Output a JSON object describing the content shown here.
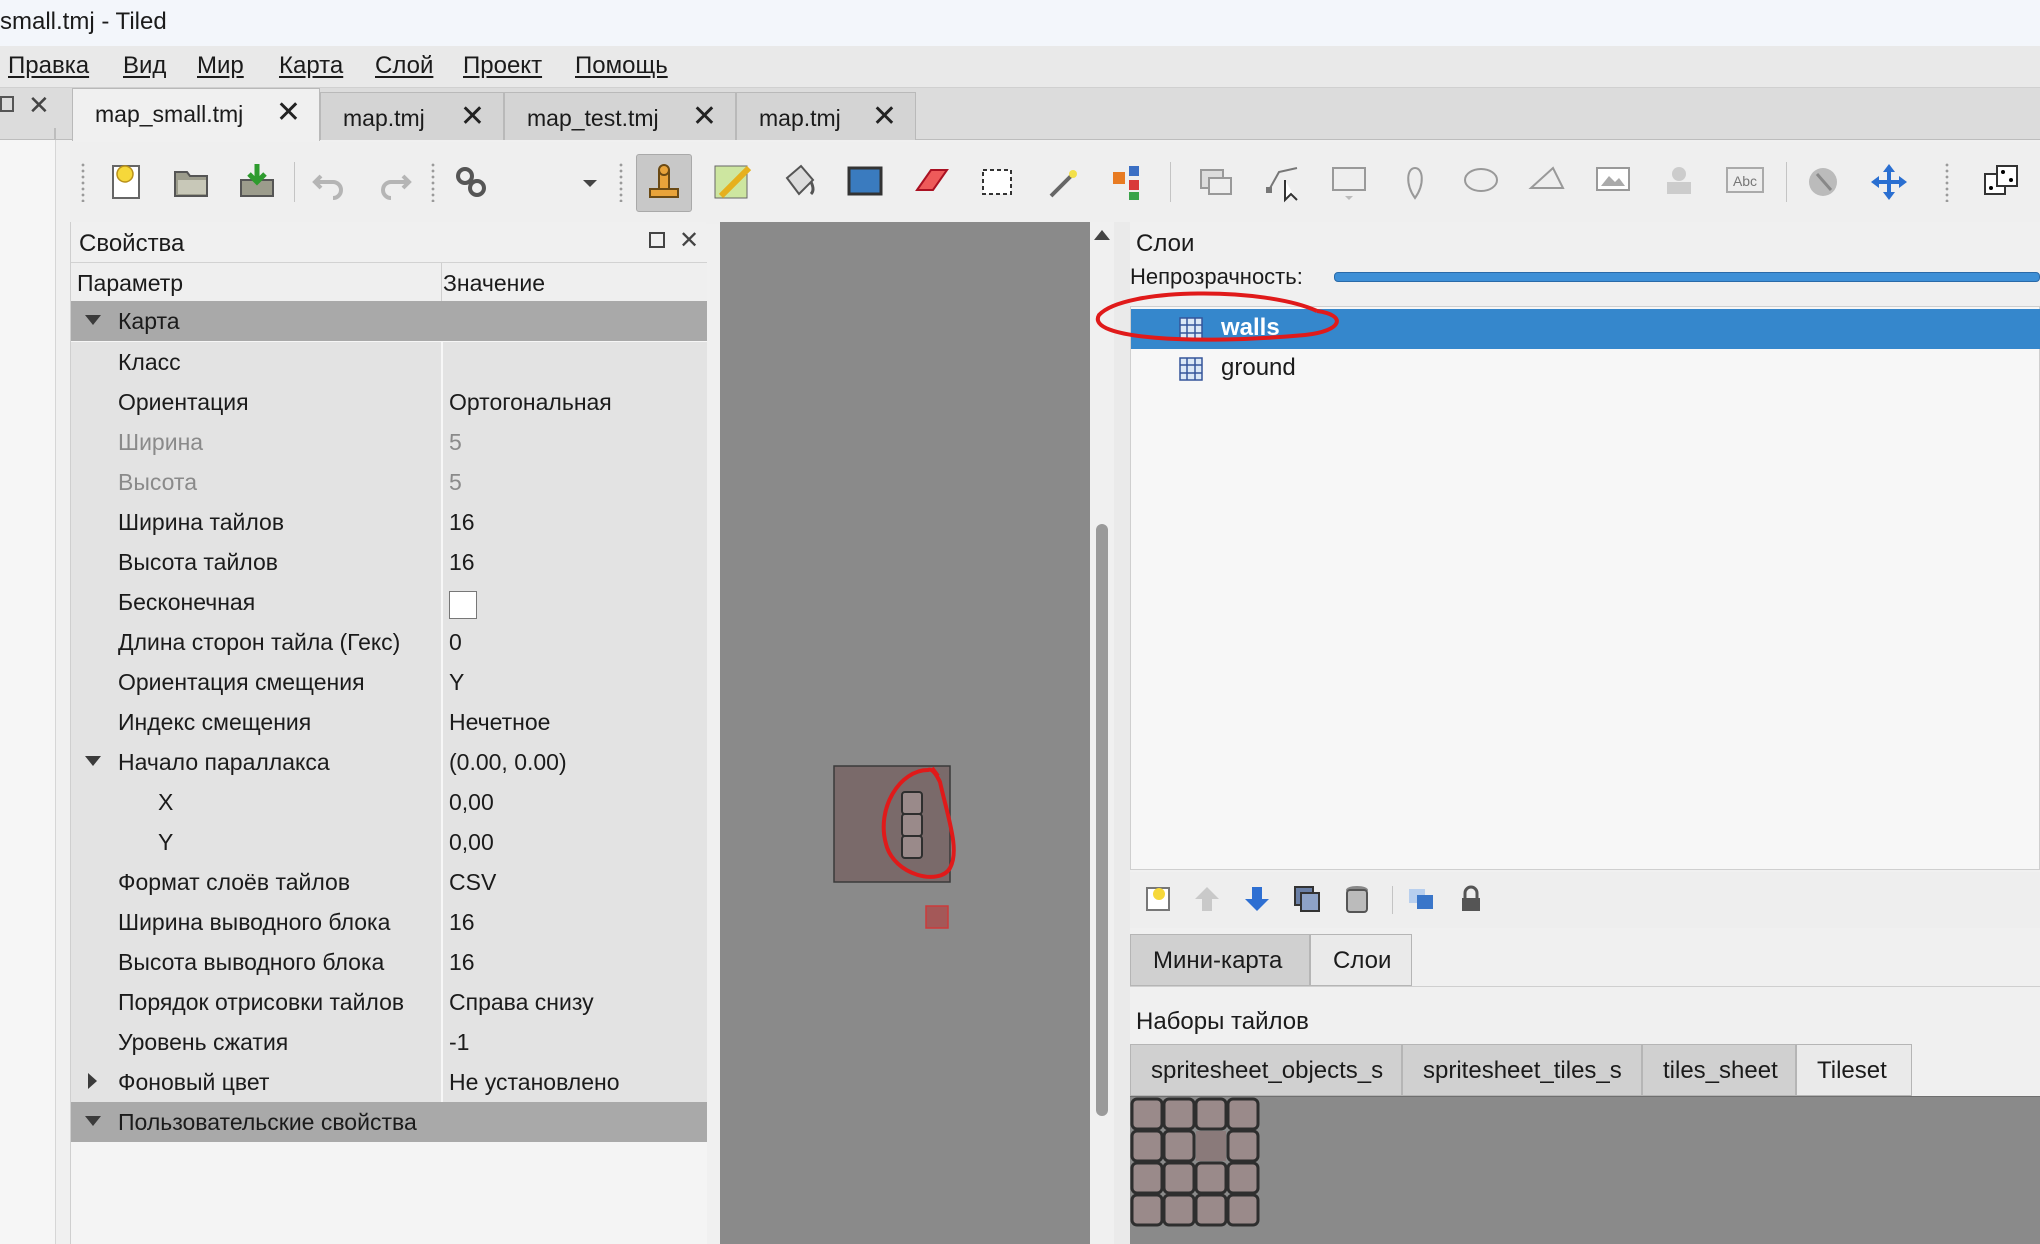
{
  "window": {
    "title": "small.tmj - Tiled"
  },
  "menu": [
    "Правка",
    "Вид",
    "Мир",
    "Карта",
    "Слой",
    "Проект",
    "Помощь"
  ],
  "tabs": [
    {
      "label": "map_small.tmj",
      "active": true
    },
    {
      "label": "map.tmj",
      "active": false
    },
    {
      "label": "map_test.tmj",
      "active": false
    },
    {
      "label": "map.tmj",
      "active": false
    }
  ],
  "toolbar_icons": [
    "new-map-icon",
    "open-icon",
    "save-icon",
    "undo-icon",
    "redo-icon",
    "commands-icon",
    "dropdown-icon",
    "stamp-brush-icon",
    "terrain-brush-icon",
    "bucket-fill-icon",
    "shape-fill-icon",
    "eraser-icon",
    "rect-select-icon",
    "magic-wand-icon",
    "select-same-tile-icon",
    "select-objects-icon",
    "edit-polygons-icon",
    "insert-rectangle-icon",
    "insert-point-icon",
    "insert-ellipse-icon",
    "insert-polygon-icon",
    "insert-tile-icon",
    "insert-template-icon",
    "insert-text-icon",
    "world-tool-icon",
    "move-tool-icon",
    "random-mode-icon",
    "wang-fill-icon"
  ],
  "properties": {
    "panel_title": "Свойства",
    "header": {
      "name": "Параметр",
      "value": "Значение"
    },
    "group_map": "Карта",
    "rows": [
      {
        "name": "Класс",
        "value": ""
      },
      {
        "name": "Ориентация",
        "value": "Ортогональная"
      },
      {
        "name": "Ширина",
        "value": "5",
        "disabled": true
      },
      {
        "name": "Высота",
        "value": "5",
        "disabled": true
      },
      {
        "name": "Ширина тайлов",
        "value": "16"
      },
      {
        "name": "Высота тайлов",
        "value": "16"
      },
      {
        "name": "Бесконечная",
        "value": "",
        "checkbox": true,
        "checked": false
      },
      {
        "name": "Длина сторон тайла (Гекс)",
        "value": "0"
      },
      {
        "name": "Ориентация смещения",
        "value": "Y"
      },
      {
        "name": "Индекс смещения",
        "value": "Нечетное"
      },
      {
        "name": "Начало параллакса",
        "value": "(0.00, 0.00)",
        "expanded": true
      },
      {
        "name": "X",
        "value": "0,00",
        "child": true
      },
      {
        "name": "Y",
        "value": "0,00",
        "child": true
      },
      {
        "name": "Формат слоёв тайлов",
        "value": "CSV"
      },
      {
        "name": "Ширина выводного блока",
        "value": "16"
      },
      {
        "name": "Высота выводного блока",
        "value": "16"
      },
      {
        "name": "Порядок отрисовки тайлов",
        "value": "Справа снизу"
      },
      {
        "name": "Уровень сжатия",
        "value": "-1"
      },
      {
        "name": "Фоновый цвет",
        "value": "Не установлено",
        "collapsed": true
      }
    ],
    "group_custom": "Пользовательские свойства"
  },
  "layers": {
    "title": "Слои",
    "opacity_label": "Непрозрачность:",
    "items": [
      {
        "name": "walls",
        "selected": true
      },
      {
        "name": "ground",
        "selected": false
      }
    ],
    "action_icons": [
      "new-layer-icon",
      "raise-layer-icon",
      "lower-layer-icon",
      "duplicate-layer-icon",
      "delete-layer-icon",
      "toggle-other-layers-icon",
      "lock-layer-icon"
    ]
  },
  "dock_tabs": [
    {
      "label": "Мини-карта",
      "active": false
    },
    {
      "label": "Слои",
      "active": true
    }
  ],
  "tilesets": {
    "title": "Наборы тайлов",
    "tabs": [
      {
        "label": "spritesheet_objects_s",
        "active": false
      },
      {
        "label": "spritesheet_tiles_s",
        "active": false
      },
      {
        "label": "tiles_sheet",
        "active": false
      },
      {
        "label": "Tileset",
        "active": true
      }
    ]
  },
  "colors": {
    "selection": "#3587cc",
    "canvas": "#8a8a8a",
    "annotation": "#e01a1a"
  }
}
